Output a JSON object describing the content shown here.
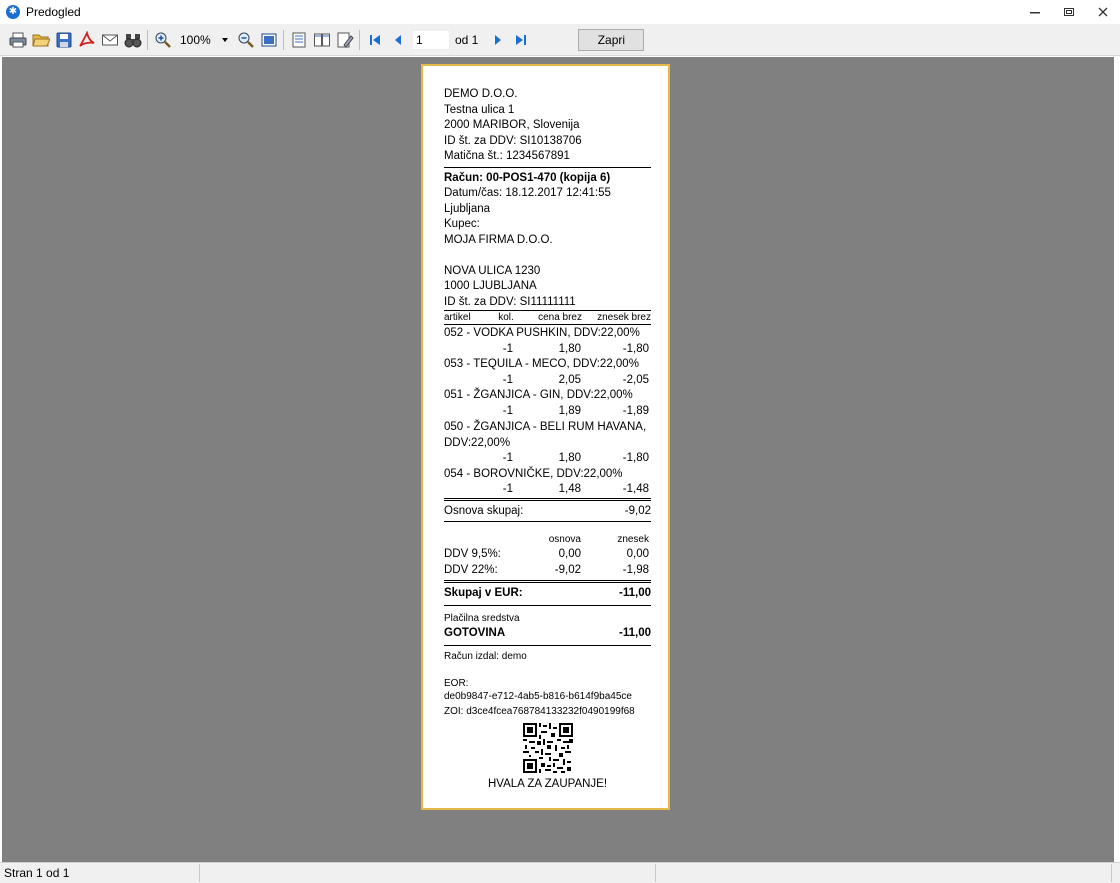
{
  "window": {
    "title": "Predogled"
  },
  "toolbar": {
    "zoom_value": "100%",
    "page_number": "1",
    "page_of": "od 1",
    "close_label": "Zapri"
  },
  "receipt": {
    "company_name": "DEMO D.O.O.",
    "company_street": "Testna ulica 1",
    "company_city": "2000 MARIBOR, Slovenija",
    "company_vat": "ID št. za DDV: SI10138706",
    "company_reg": "Matična št.: 1234567891",
    "invoice_title": "Račun: 00-POS1-470 (kopija 6)",
    "datetime": "Datum/čas: 18.12.2017 12:41:55",
    "location": "Ljubljana",
    "buyer_label": "Kupec:",
    "buyer_name": "MOJA FIRMA D.O.O.",
    "buyer_street": "NOVA ULICA 1230",
    "buyer_city": "1000  LJUBLJANA",
    "buyer_vat": "ID št. za DDV: SI11111111",
    "col_headers": [
      "artikel",
      "kol.",
      "cena brez",
      "znesek brez"
    ],
    "items": [
      {
        "name": "052 - VODKA PUSHKIN, DDV:22,00%",
        "qty": "-1",
        "price": "1,80",
        "amount": "-1,80"
      },
      {
        "name": "053 - TEQUILA - MECO, DDV:22,00%",
        "qty": "-1",
        "price": "2,05",
        "amount": "-2,05"
      },
      {
        "name": "051 - ŽGANJICA - GIN, DDV:22,00%",
        "qty": "-1",
        "price": "1,89",
        "amount": "-1,89"
      },
      {
        "name": "050 - ŽGANJICA - BELI RUM HAVANA,",
        "name2": "DDV:22,00%",
        "qty": "-1",
        "price": "1,80",
        "amount": "-1,80"
      },
      {
        "name": "054 - BOROVNIČKE, DDV:22,00%",
        "qty": "-1",
        "price": "1,48",
        "amount": "-1,48"
      }
    ],
    "base_total_label": "Osnova skupaj:",
    "base_total_value": "-9,02",
    "tax_col_base": "osnova",
    "tax_col_amount": "znesek",
    "tax_rows": [
      {
        "label": "DDV 9,5%:",
        "base": "0,00",
        "amount": "0,00"
      },
      {
        "label": "DDV 22%:",
        "base": "-9,02",
        "amount": "-1,98"
      }
    ],
    "total_label": "Skupaj v EUR:",
    "total_value": "-11,00",
    "payment_label": "Plačilna sredstva",
    "payment_method": "GOTOVINA",
    "payment_value": "-11,00",
    "issued_by": "Račun izdal: demo",
    "eor_label": "EOR:",
    "eor_value": "de0b9847-e712-4ab5-b816-b614f9ba45ce",
    "zoi": "ZOI: d3ce4fcea768784133232f0490199f68",
    "thanks": "HVALA ZA ZAUPANJE!"
  },
  "status": {
    "page_info": "Stran 1 od 1"
  }
}
